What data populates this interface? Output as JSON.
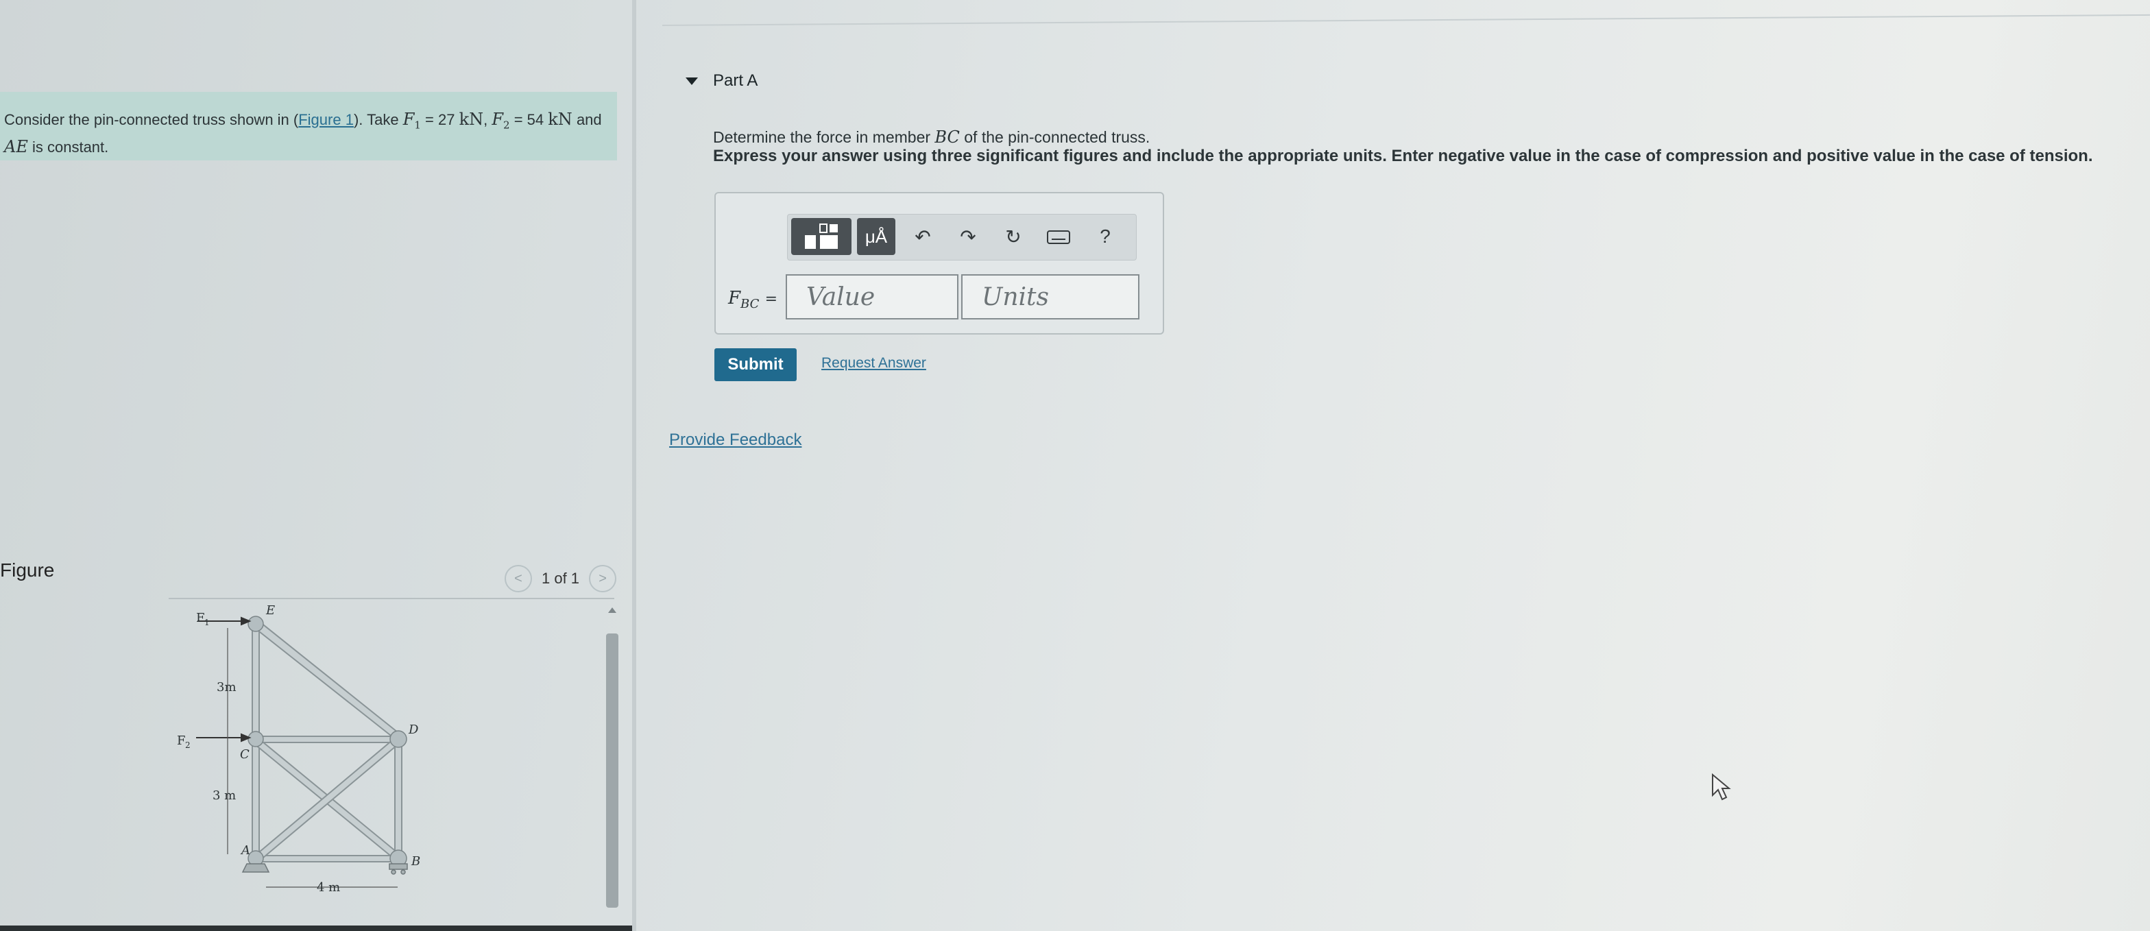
{
  "problem": {
    "text_before": "Consider the pin-connected truss shown in (",
    "figure_link": "Figure 1",
    "text_after": "). Take",
    "f1_sym": "F",
    "f1_sub": "1",
    "f1_val": "= 27",
    "f1_unit": "kN",
    "f2_sym": "F",
    "f2_sub": "2",
    "f2_val": "= 54",
    "f2_unit": "kN",
    "and": "and",
    "ae_sym": "AE",
    "ae_text": "is constant."
  },
  "figure": {
    "heading": "Figure",
    "pager": "1 of 1",
    "prev_glyph": "<",
    "next_glyph": ">",
    "labels": {
      "f1": "F",
      "f1_sub": "1",
      "f2": "F",
      "f2_sub": "2",
      "e": "E",
      "d": "D",
      "c": "C",
      "a": "A",
      "b": "B",
      "dim1": "3m",
      "dim2": "3 m",
      "dim3": "4 m"
    }
  },
  "part": {
    "title": "Part A",
    "question_pre": "Determine the force in member",
    "member": "BC",
    "question_post": "of the pin-connected truss.",
    "instructions": "Express your answer using three significant figures and include the appropriate units. Enter negative value in the case of compression and positive value in the case of tension.",
    "toolbar": {
      "templates_icon": "templates-icon",
      "units_label": "μÅ",
      "undo_icon": "undo-icon",
      "redo_icon": "redo-icon",
      "reset_icon": "reset-icon",
      "keyboard_icon": "keyboard-icon",
      "help_label": "?"
    },
    "answer_label_f": "F",
    "answer_label_sub": "BC",
    "answer_label_eq": "=",
    "value_placeholder": "Value",
    "units_placeholder": "Units",
    "submit_label": "Submit",
    "request_answer_label": "Request Answer",
    "feedback_label": "Provide Feedback"
  },
  "colors": {
    "accent": "#206a8e",
    "link": "#2e7196",
    "problem_bg": "#bdd8d3"
  }
}
